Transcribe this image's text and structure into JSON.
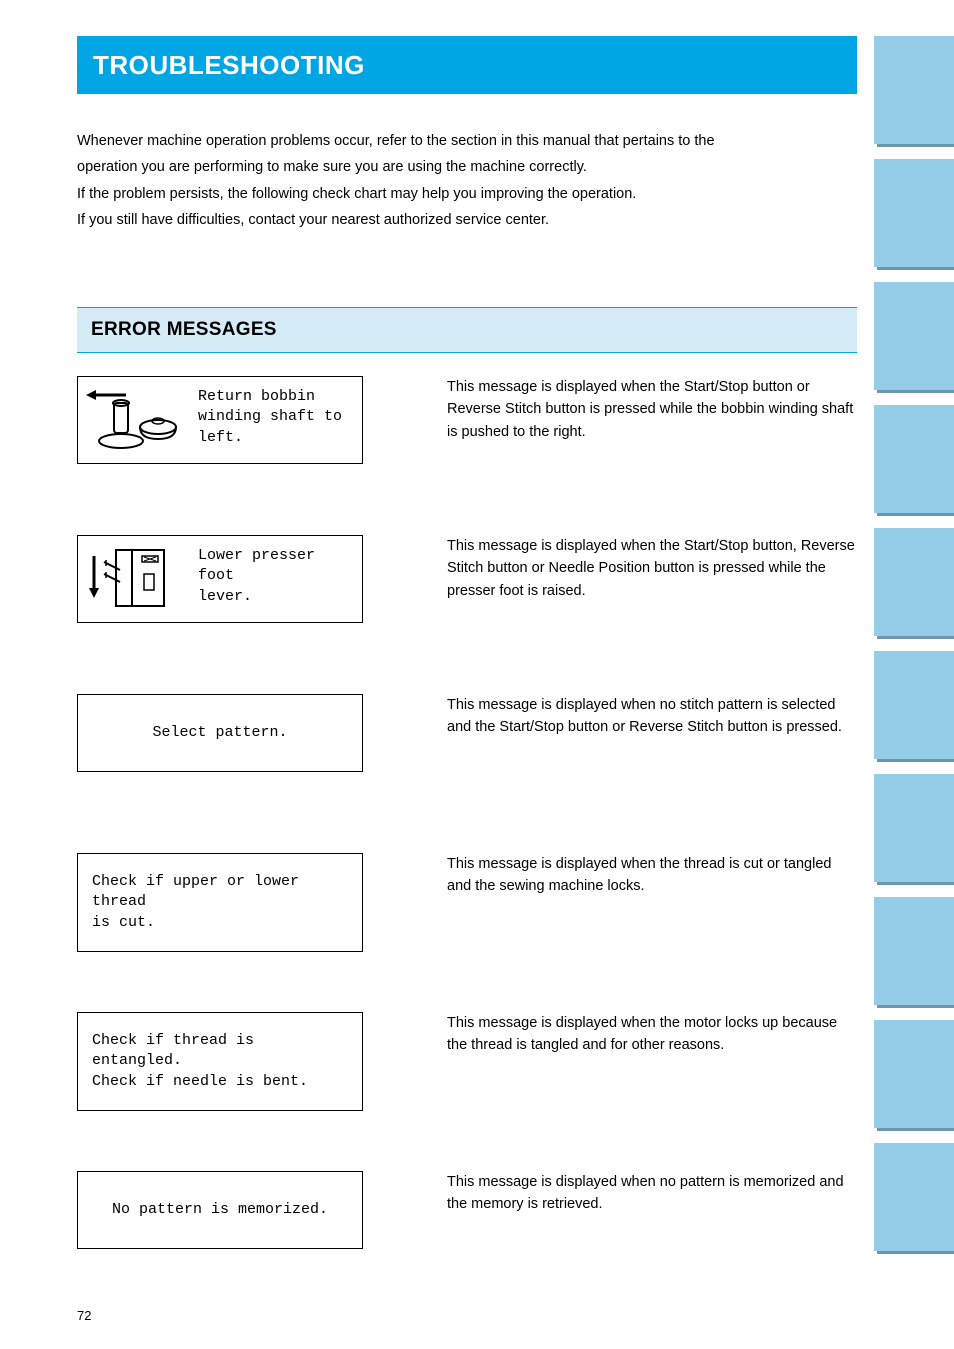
{
  "header": {
    "title": "TROUBLESHOOTING"
  },
  "intro": {
    "line1": "Whenever machine operation problems occur, refer to the section in this manual that pertains to the",
    "line2": "operation you are performing to make sure you are using the machine correctly.",
    "line3": "If the problem persists, the following check chart may help you improving the operation.",
    "line4": "If you still have difficulties, contact your nearest authorized service center."
  },
  "subheader": {
    "title": "ERROR MESSAGES"
  },
  "entries": [
    {
      "msg_line1": "Return bobbin",
      "msg_line2": "winding shaft to",
      "msg_line3": "left.",
      "desc": "This message is displayed when the Start/Stop button or Reverse Stitch button is pressed while the bobbin winding shaft is pushed to the right."
    },
    {
      "msg_line1": "Lower presser foot",
      "msg_line2": "lever.",
      "desc": "This message is displayed when the Start/Stop button, Reverse Stitch button or Needle Position button is pressed while the presser foot is raised."
    },
    {
      "msg_line1": "Select pattern.",
      "desc": "This message is displayed when no stitch pattern is selected and the Start/Stop button or Reverse Stitch button is pressed."
    },
    {
      "msg_line1": "Check if upper or lower thread",
      "msg_line2": "is cut.",
      "desc": "This message is displayed when the thread is cut or tangled and the sewing machine locks."
    },
    {
      "msg_line1": "Check if thread is entangled.",
      "msg_line2": "Check if needle is bent.",
      "desc": "This message is displayed when the motor locks up because the thread is tangled and for other reasons."
    },
    {
      "msg_line1": "No pattern is memorized.",
      "desc": "This message is displayed when no pattern is memorized and the memory is retrieved."
    }
  ],
  "tabs": [
    "",
    "",
    "",
    "",
    "",
    "",
    "",
    "",
    "",
    ""
  ],
  "page_number": "72"
}
